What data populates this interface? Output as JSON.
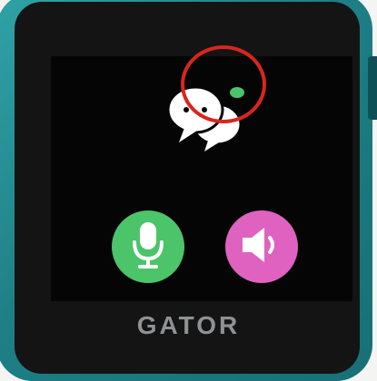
{
  "device": {
    "brand_text": "GATOR"
  },
  "screen": {
    "messages_icon": "chat-bubbles-icon",
    "notification_icon": "new-message-dot-icon",
    "buttons": {
      "voice_icon": "microphone-icon",
      "volume_icon": "speaker-icon"
    }
  },
  "annotation": {
    "highlight_color": "#d9261c"
  },
  "colors": {
    "watch_case": "#1e7f86",
    "voice_button": "#4cc46a",
    "volume_button": "#e062c0"
  }
}
